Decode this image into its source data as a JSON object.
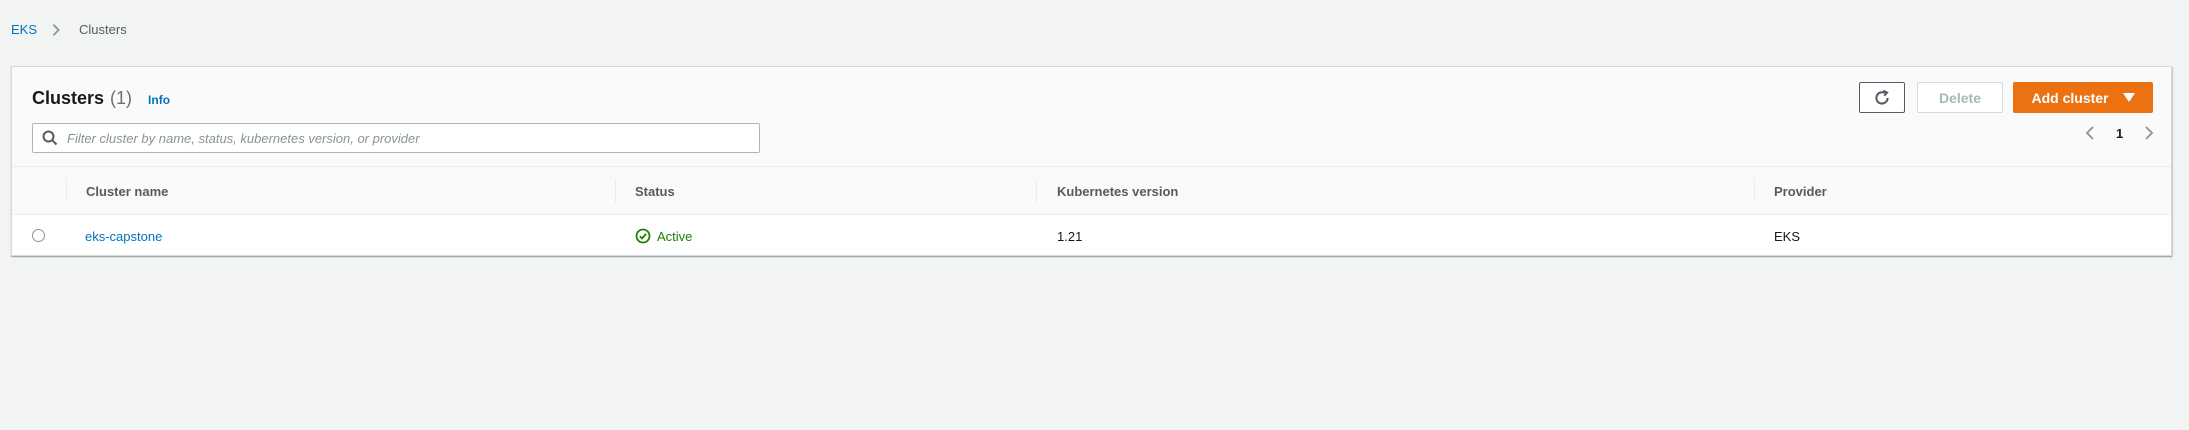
{
  "breadcrumb": {
    "root": "EKS",
    "current": "Clusters"
  },
  "panel": {
    "title": "Clusters",
    "count": "(1)",
    "info": "Info"
  },
  "toolbar": {
    "refresh_icon": "refresh-icon",
    "delete_label": "Delete",
    "add_label": "Add cluster"
  },
  "search": {
    "placeholder": "Filter cluster by name, status, kubernetes version, or provider",
    "value": ""
  },
  "pagination": {
    "page": "1"
  },
  "table": {
    "columns": [
      "Cluster name",
      "Status",
      "Kubernetes version",
      "Provider"
    ],
    "rows": [
      {
        "name": "eks-capstone",
        "status": "Active",
        "version": "1.21",
        "provider": "EKS"
      }
    ]
  },
  "colors": {
    "accent": "#ec7211",
    "link": "#0073bb",
    "success": "#1d8102"
  }
}
